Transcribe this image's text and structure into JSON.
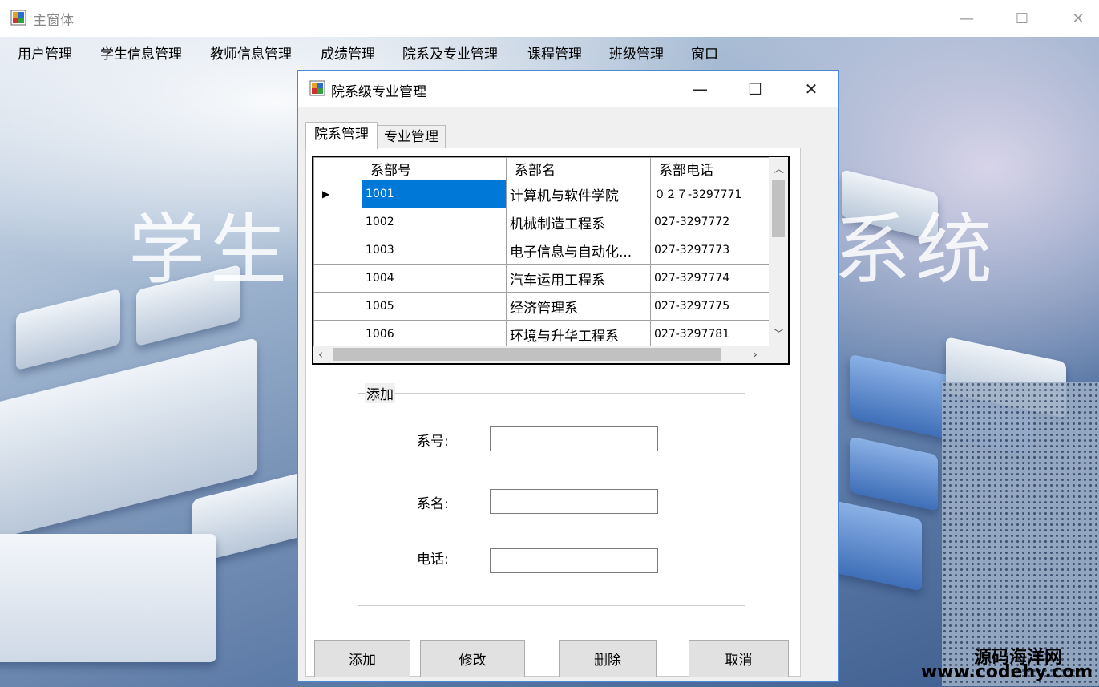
{
  "main_window": {
    "title": "主窗体",
    "minimize": "—",
    "maximize": "☐",
    "close": "✕"
  },
  "menu": [
    "用户管理",
    "学生信息管理",
    "教师信息管理",
    "成绩管理",
    "院系及专业管理",
    "课程管理",
    "班级管理",
    "窗口"
  ],
  "background_title": {
    "left": "学生",
    "right": "系统"
  },
  "dialog": {
    "title": "院系级专业管理",
    "tabs": [
      "院系管理",
      "专业管理"
    ],
    "grid": {
      "columns": [
        "系部号",
        "系部名",
        "系部电话"
      ],
      "rows": [
        {
          "id": "1001",
          "name": "计算机与软件学院",
          "phone": "０２７-3297771",
          "selected": true
        },
        {
          "id": "1002",
          "name": "机械制造工程系",
          "phone": "027-3297772"
        },
        {
          "id": "1003",
          "name": "电子信息与自动化...",
          "phone": "027-3297773"
        },
        {
          "id": "1004",
          "name": "汽车运用工程系",
          "phone": "027-3297774"
        },
        {
          "id": "1005",
          "name": "经济管理系",
          "phone": "027-3297775"
        },
        {
          "id": "1006",
          "name": "环境与升华工程系",
          "phone": "027-3297781"
        }
      ],
      "row_indicator": "▶"
    },
    "group": {
      "title": "添加",
      "fields": [
        {
          "label": "系号:",
          "value": ""
        },
        {
          "label": "系名:",
          "value": ""
        },
        {
          "label": "电话:",
          "value": ""
        }
      ]
    },
    "buttons": [
      "添加",
      "修改",
      "删除",
      "取消"
    ]
  },
  "watermark": {
    "name": "源码海洋网",
    "url": "www.codehy.com"
  }
}
